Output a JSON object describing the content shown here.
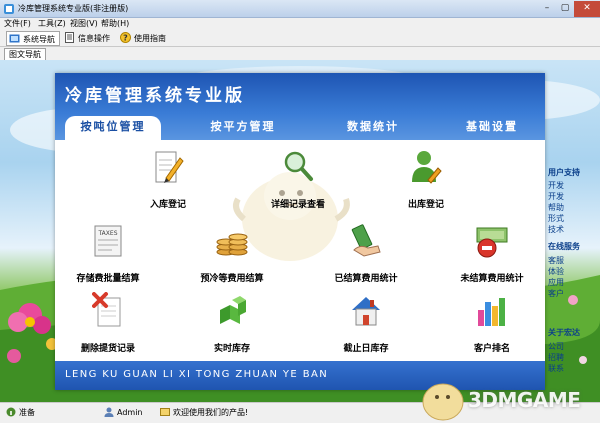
{
  "window": {
    "title": "冷库管理系统专业版(非注册版)",
    "controls": {
      "minimize": "–",
      "maximize": "▢",
      "close": "✕"
    }
  },
  "menu": [
    "文件(F)",
    "工具(Z)",
    "视图(V)",
    "帮助(H)"
  ],
  "toolbar": {
    "system_nav": "系统导航",
    "info_ops": "信息操作",
    "user_guide": "使用指南"
  },
  "nav_tab": "图文导航",
  "dashboard": {
    "title": "冷库管理系统专业版",
    "tabs": [
      "按吨位管理",
      "按平方管理",
      "数据统计",
      "基础设置"
    ],
    "active_tab": "按吨位管理",
    "items": [
      {
        "label": "入库登记",
        "icon": "pencil-paper-icon"
      },
      {
        "label": "详细记录查看",
        "icon": "magnifier-icon"
      },
      {
        "label": "出库登记",
        "icon": "user-edit-icon"
      },
      {
        "label": "存储费批量结算",
        "icon": "taxes-form-icon"
      },
      {
        "label": "预冷等费用结算",
        "icon": "coin-stack-icon"
      },
      {
        "label": "已结算费用统计",
        "icon": "money-hand-icon"
      },
      {
        "label": "未结算费用统计",
        "icon": "banknote-remove-icon"
      },
      {
        "label": "删除提货记录",
        "icon": "delete-document-icon"
      },
      {
        "label": "实时库存",
        "icon": "green-cubes-icon"
      },
      {
        "label": "截止日库存",
        "icon": "house-icon"
      },
      {
        "label": "客户排名",
        "icon": "bar-chart-icon"
      }
    ],
    "footer": "LENG KU GUAN LI XI TONG ZHUAN YE BAN"
  },
  "side_panel": [
    "用户支持",
    "开发",
    "开发",
    "帮助",
    "形式",
    "技术",
    "在线服务",
    "客服",
    "体验",
    "应用",
    "客户",
    "关于宏达",
    "公司",
    "招聘",
    "联系"
  ],
  "status": {
    "ready": "准备",
    "user": "Admin",
    "welcome": "欢迎使用我们的产品!"
  },
  "watermark": "3DMGAME",
  "colors": {
    "dashboard_blue": "#2a66c5",
    "footer_blue": "#1f55b0",
    "title_white": "#ffffff"
  }
}
